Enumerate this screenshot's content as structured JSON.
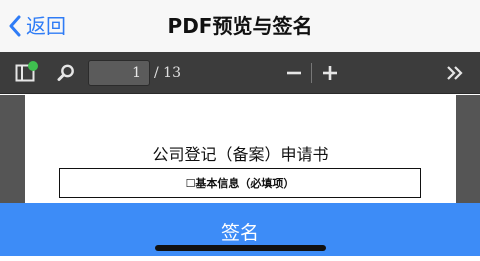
{
  "navbar": {
    "back_label": "返回",
    "title": "PDF预览与签名"
  },
  "toolbar": {
    "sidebar_icon": "sidebar-toggle-icon",
    "search_icon": "search-icon",
    "page_current": "1",
    "page_total": "/ 13",
    "zoom_out_icon": "minus-icon",
    "zoom_in_icon": "plus-icon",
    "more_icon": "double-chevron-right-icon",
    "notification_color": "#3fbf4f"
  },
  "document": {
    "title": "公司登记（备案）申请书",
    "section_title": "☐基本信息（必填项）"
  },
  "footer": {
    "sign_label": "签名",
    "accent_color": "#3d8cf7"
  }
}
